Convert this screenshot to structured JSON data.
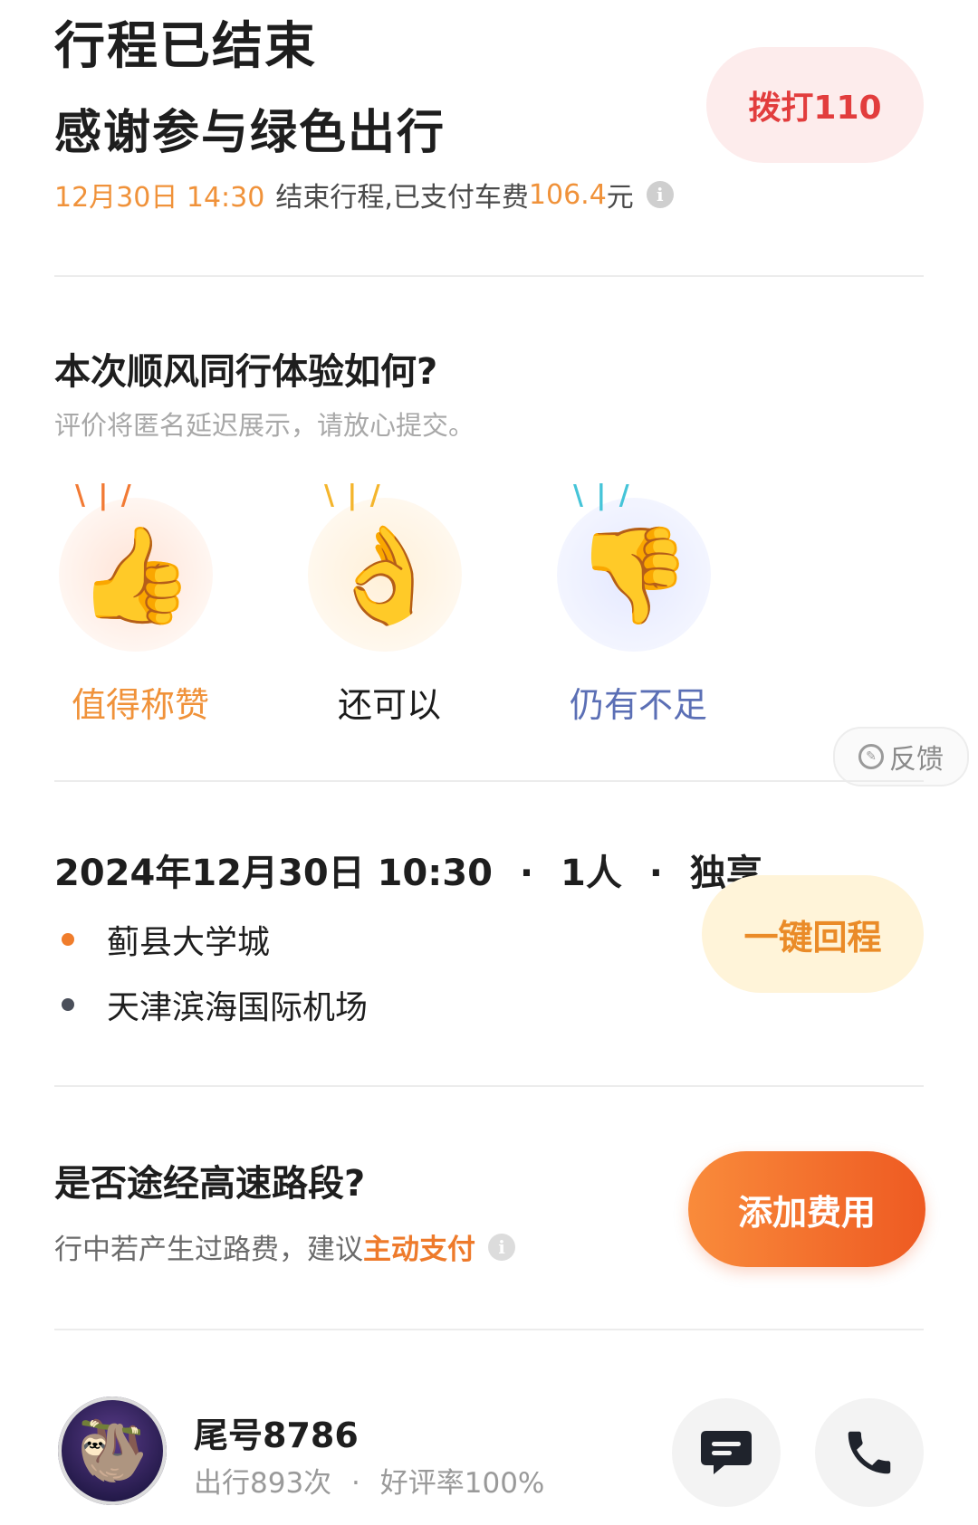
{
  "header": {
    "title": "行程已结束",
    "subtitle": "感谢参与绿色出行",
    "call_button": "拨打110",
    "summary_datetime": "12月30日 14:30",
    "summary_text": "结束行程,已支付车费",
    "summary_fare": "106.4",
    "summary_unit": "元"
  },
  "rating": {
    "question": "本次顺风同行体验如何?",
    "note": "评价将匿名延迟展示，请放心提交。",
    "options": [
      {
        "label": "值得称赞",
        "icon": "thumbs-up-icon",
        "color": "#f0923a"
      },
      {
        "label": "还可以",
        "icon": "ok-hand-icon",
        "color": "#1b1b1b"
      },
      {
        "label": "仍有不足",
        "icon": "thumbs-down-icon",
        "color": "#5b6fb5"
      }
    ],
    "feedback_label": "反馈"
  },
  "trip": {
    "datetime": "2024年12月30日 10:30",
    "passengers": "1人",
    "mode": "独享",
    "separator": "·",
    "origin": "蓟县大学城",
    "destination": "天津滨海国际机场",
    "return_button": "一键回程"
  },
  "highway": {
    "question": "是否途经高速路段?",
    "tip_prefix": "行中若产生过路费，建议",
    "tip_highlight": "主动支付",
    "add_fee_button": "添加费用"
  },
  "driver": {
    "name": "尾号8786",
    "trips": "出行893次",
    "separator": "·",
    "rating": "好评率100%"
  },
  "colors": {
    "accent_orange": "#ee5a22",
    "danger_red": "#e23d3d",
    "return_yellow_bg": "#fff4d9"
  }
}
